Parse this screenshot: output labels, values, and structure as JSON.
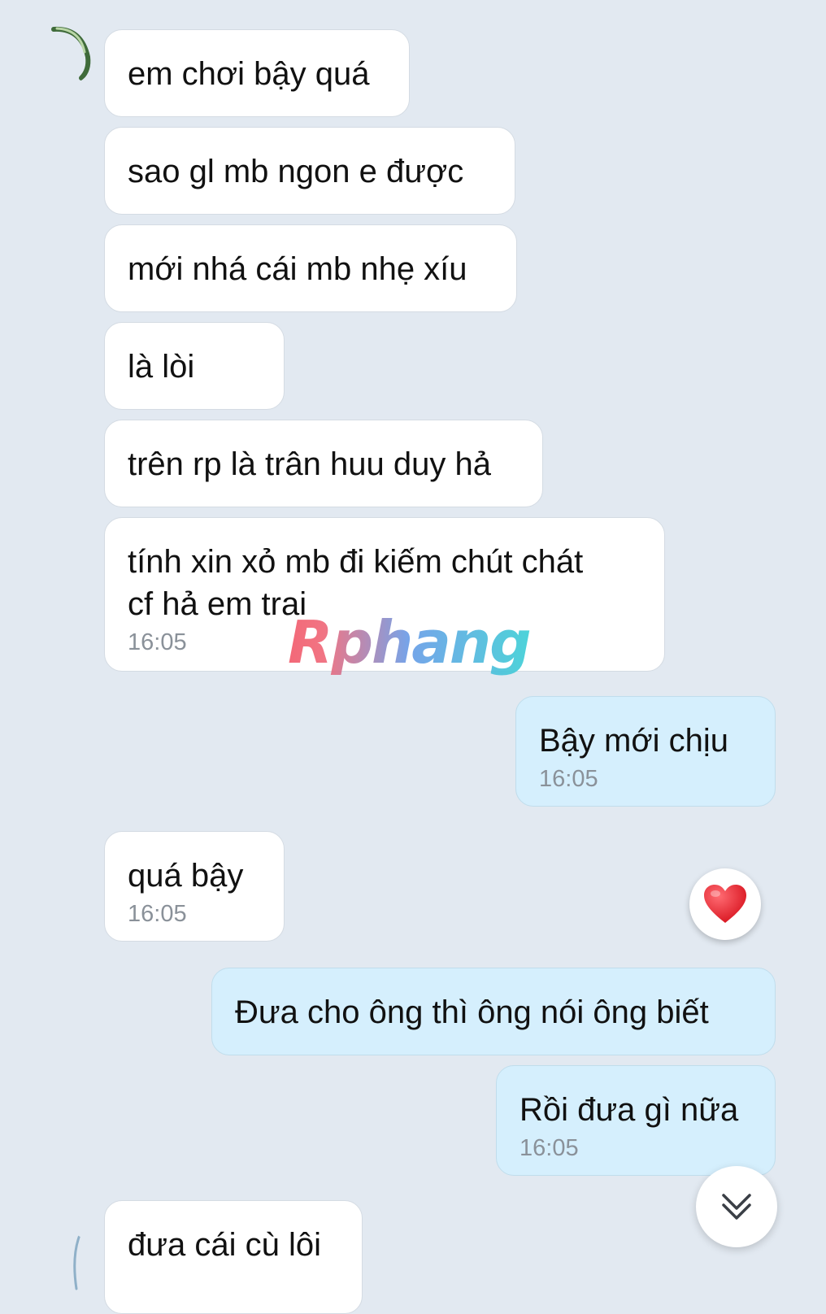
{
  "messages": [
    {
      "side": "in",
      "text": "em chơi bậy quá"
    },
    {
      "side": "in",
      "text": "sao gl mb ngon e được"
    },
    {
      "side": "in",
      "text": "mới nhá cái mb nhẹ xíu"
    },
    {
      "side": "in",
      "text": "là lòi"
    },
    {
      "side": "in",
      "text": "trên rp là trân huu duy hả"
    },
    {
      "side": "in",
      "text": "tính xin xỏ mb đi kiếm chút chát\ncf hả em trai",
      "time": "16:05"
    },
    {
      "side": "out",
      "text": "Bậy mới chịu",
      "time": "16:05"
    },
    {
      "side": "in",
      "text": "quá bậy",
      "time": "16:05"
    },
    {
      "side": "out",
      "text": "Đưa cho ông thì ông nói ông biết"
    },
    {
      "side": "out",
      "text": "Rồi đưa gì nữa",
      "time": "16:05"
    },
    {
      "side": "in",
      "text": "đưa cái cù lôi"
    }
  ],
  "watermark": "Rphang",
  "reaction": {
    "icon": "heart-icon",
    "color": "#e8202c"
  },
  "scroll_button": {
    "icon": "double-chevron-down-icon"
  },
  "colors": {
    "background": "#e2e9f1",
    "incoming_bubble": "#ffffff",
    "outgoing_bubble": "#d5effd",
    "timestamp": "#8a9199"
  }
}
